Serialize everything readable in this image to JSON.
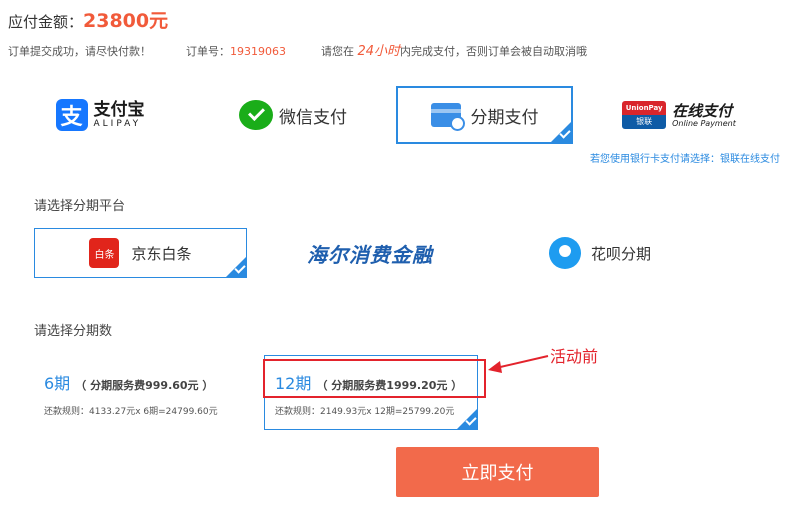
{
  "header": {
    "amount_label": "应付金额：",
    "amount_value": "23800元"
  },
  "notice": {
    "submitted": "订单提交成功，请尽快付款！",
    "order_label": "订单号：",
    "order_no": "19319063",
    "deadline_prefix": "请您在",
    "deadline_value": "24小时",
    "deadline_suffix": "内完成支付，否则订单会被自动取消哦"
  },
  "payment_methods": {
    "alipay_cn": "支付宝",
    "alipay_en": "ALIPAY",
    "wechat": "微信支付",
    "installment": "分期支付",
    "unionpay_top": "UnionPay",
    "unionpay_bottom": "银联",
    "online_cn": "在线支付",
    "online_en": "Online Payment",
    "selected": "分期支付",
    "bank_tip": "若您使用银行卡支付请选择：银联在线支付"
  },
  "platform": {
    "title": "请选择分期平台",
    "jd_icon": "白条",
    "jd": "京东白条",
    "haier": "海尔消费金融",
    "huabei": "花呗分期",
    "selected": "京东白条"
  },
  "periods": {
    "title": "请选择分期数",
    "items": [
      {
        "name": "6期",
        "fee": "（ 分期服务费999.60元 ）",
        "rule": "还款规则：4133.27元x 6期=24799.60元"
      },
      {
        "name": "12期",
        "fee": "（ 分期服务费1999.20元 ）",
        "rule": "还款规则：2149.93元x 12期=25799.20元"
      }
    ],
    "selected": "12期"
  },
  "annotation": {
    "text": "活动前",
    "color": "#e3232c"
  },
  "pay_button": "立即支付",
  "colors": {
    "accent": "#2a8ae0",
    "amount": "#f15a3a",
    "button": "#f26a4b"
  }
}
